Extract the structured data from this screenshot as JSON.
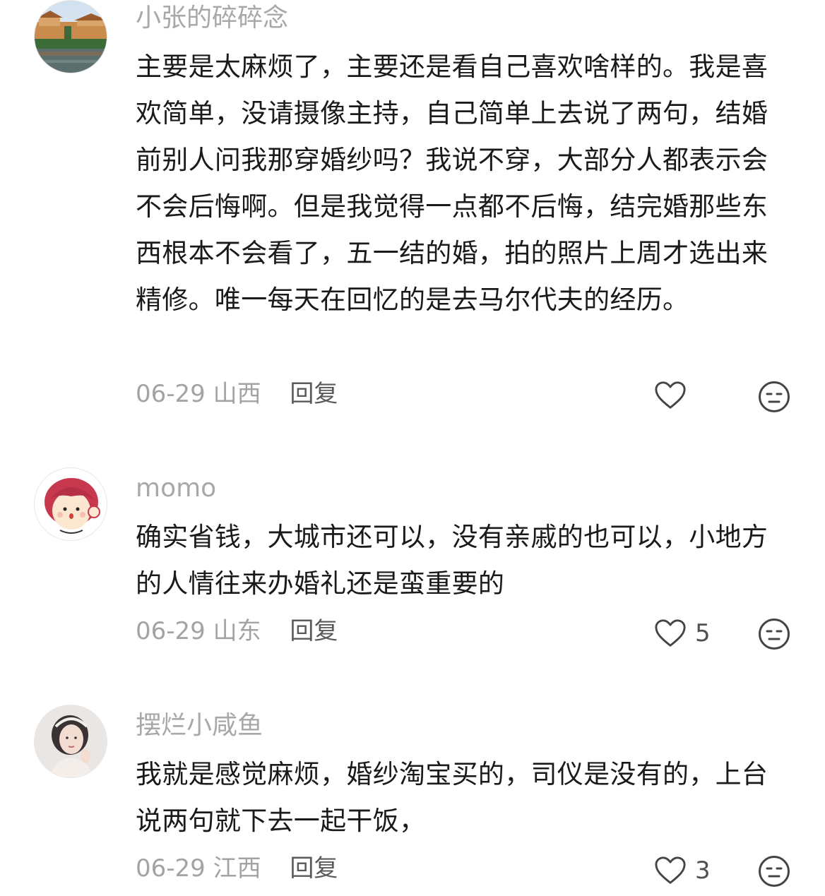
{
  "comments": [
    {
      "username": "小张的碎碎念",
      "text": "主要是太麻烦了，主要还是看自己喜欢啥样的。我是喜欢简单，没请摄像主持，自己简单上去说了两句，结婚前别人问我那穿婚纱吗？我说不穿，大部分人都表示会不会后悔啊。但是我觉得一点都不后悔，结完婚那些东西根本不会看了，五一结的婚，拍的照片上周才选出来精修。唯一每天在回忆的是去马尔代夫的经历。",
      "date": "06-29",
      "location": "山西",
      "reply_label": "回复",
      "like_count": "",
      "avatar_icon": "landscape-building-avatar"
    },
    {
      "username": "momo",
      "text": "确实省钱，大城市还可以，没有亲戚的也可以，小地方的人情往来办婚礼还是蛮重要的",
      "date": "06-29",
      "location": "山东",
      "reply_label": "回复",
      "like_count": "5",
      "avatar_icon": "cartoon-girl-avatar"
    },
    {
      "username": "摆烂小咸鱼",
      "text": "我就是感觉麻烦，婚纱淘宝买的，司仪是没有的，上台说两句就下去一起干饭，",
      "date": "06-29",
      "location": "江西",
      "reply_label": "回复",
      "like_count": "3",
      "avatar_icon": "woman-portrait-avatar"
    }
  ],
  "colors": {
    "username": "#a8a8a8",
    "body_text": "#1a1a1a",
    "meta": "#a3a3a3",
    "reply": "#5a5a5a",
    "icon": "#444444"
  }
}
